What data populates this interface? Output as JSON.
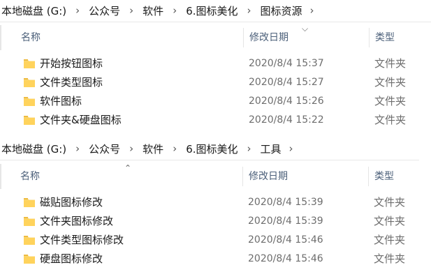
{
  "panes": [
    {
      "breadcrumb": [
        "本地磁盘 (G:)",
        "公众号",
        "软件",
        "6.图标美化",
        "图标资源"
      ],
      "columns": {
        "name": "名称",
        "date": "修改日期",
        "type": "类型"
      },
      "rows": [
        {
          "name": "开始按钮图标",
          "date": "2020/8/4 15:37",
          "type": "文件夹"
        },
        {
          "name": "文件类型图标",
          "date": "2020/8/4 15:27",
          "type": "文件夹"
        },
        {
          "name": "软件图标",
          "date": "2020/8/4 15:26",
          "type": "文件夹"
        },
        {
          "name": "文件夹&硬盘图标",
          "date": "2020/8/4 15:22",
          "type": "文件夹"
        }
      ]
    },
    {
      "breadcrumb": [
        "本地磁盘 (G:)",
        "公众号",
        "软件",
        "6.图标美化",
        "工具"
      ],
      "columns": {
        "name": "名称",
        "date": "修改日期",
        "type": "类型"
      },
      "rows": [
        {
          "name": "磁贴图标修改",
          "date": "2020/8/4 15:39",
          "type": "文件夹"
        },
        {
          "name": "文件夹图标修改",
          "date": "2020/8/4 15:39",
          "type": "文件夹"
        },
        {
          "name": "文件类型图标修改",
          "date": "2020/8/4 15:46",
          "type": "文件夹"
        },
        {
          "name": "硬盘图标修改",
          "date": "2020/8/4 15:46",
          "type": "文件夹"
        }
      ]
    }
  ],
  "icons": {
    "breadcrumb_separator": "chevron-right-icon",
    "sort_indicator": "chevron-icon",
    "row_icon": "folder-icon"
  },
  "colors": {
    "header_text": "#4c607a",
    "secondary_text": "#6d6d6d",
    "folder_yellow": "#f8d775"
  }
}
